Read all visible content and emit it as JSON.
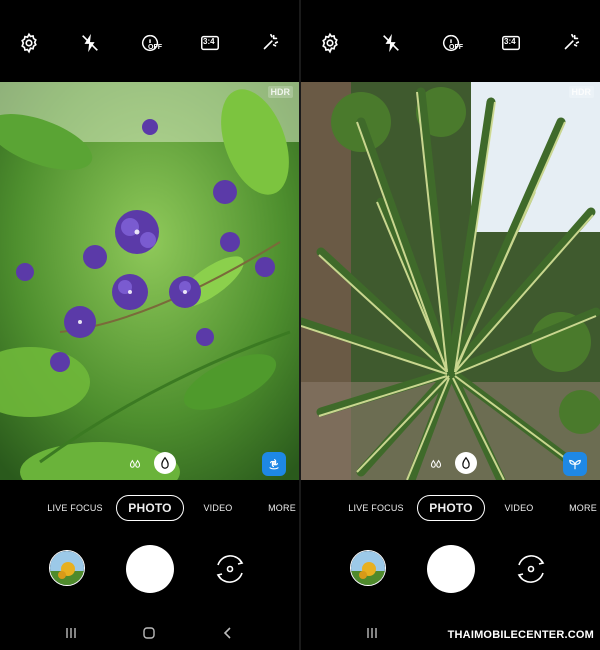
{
  "screens": [
    {
      "top_icons": [
        "settings-icon",
        "flash-off-icon",
        "timer-off-icon",
        "aspect-ratio-icon",
        "scene-optimizer-icon"
      ],
      "timer_label": "OFF",
      "ratio_label": "3:4",
      "hdr_label": "HDR",
      "scene_icon": "flower-icon",
      "modes": [
        "LIVE FOCUS",
        "PHOTO",
        "VIDEO",
        "MORE"
      ],
      "selected_mode": "PHOTO"
    },
    {
      "top_icons": [
        "settings-icon",
        "flash-off-icon",
        "timer-off-icon",
        "aspect-ratio-icon",
        "scene-optimizer-icon"
      ],
      "timer_label": "OFF",
      "ratio_label": "3:4",
      "hdr_label": "HDR",
      "scene_icon": "plant-icon",
      "modes": [
        "LIVE FOCUS",
        "PHOTO",
        "VIDEO",
        "MORE"
      ],
      "selected_mode": "PHOTO"
    }
  ],
  "watermark": "THAIMOBILECENTER.COM"
}
